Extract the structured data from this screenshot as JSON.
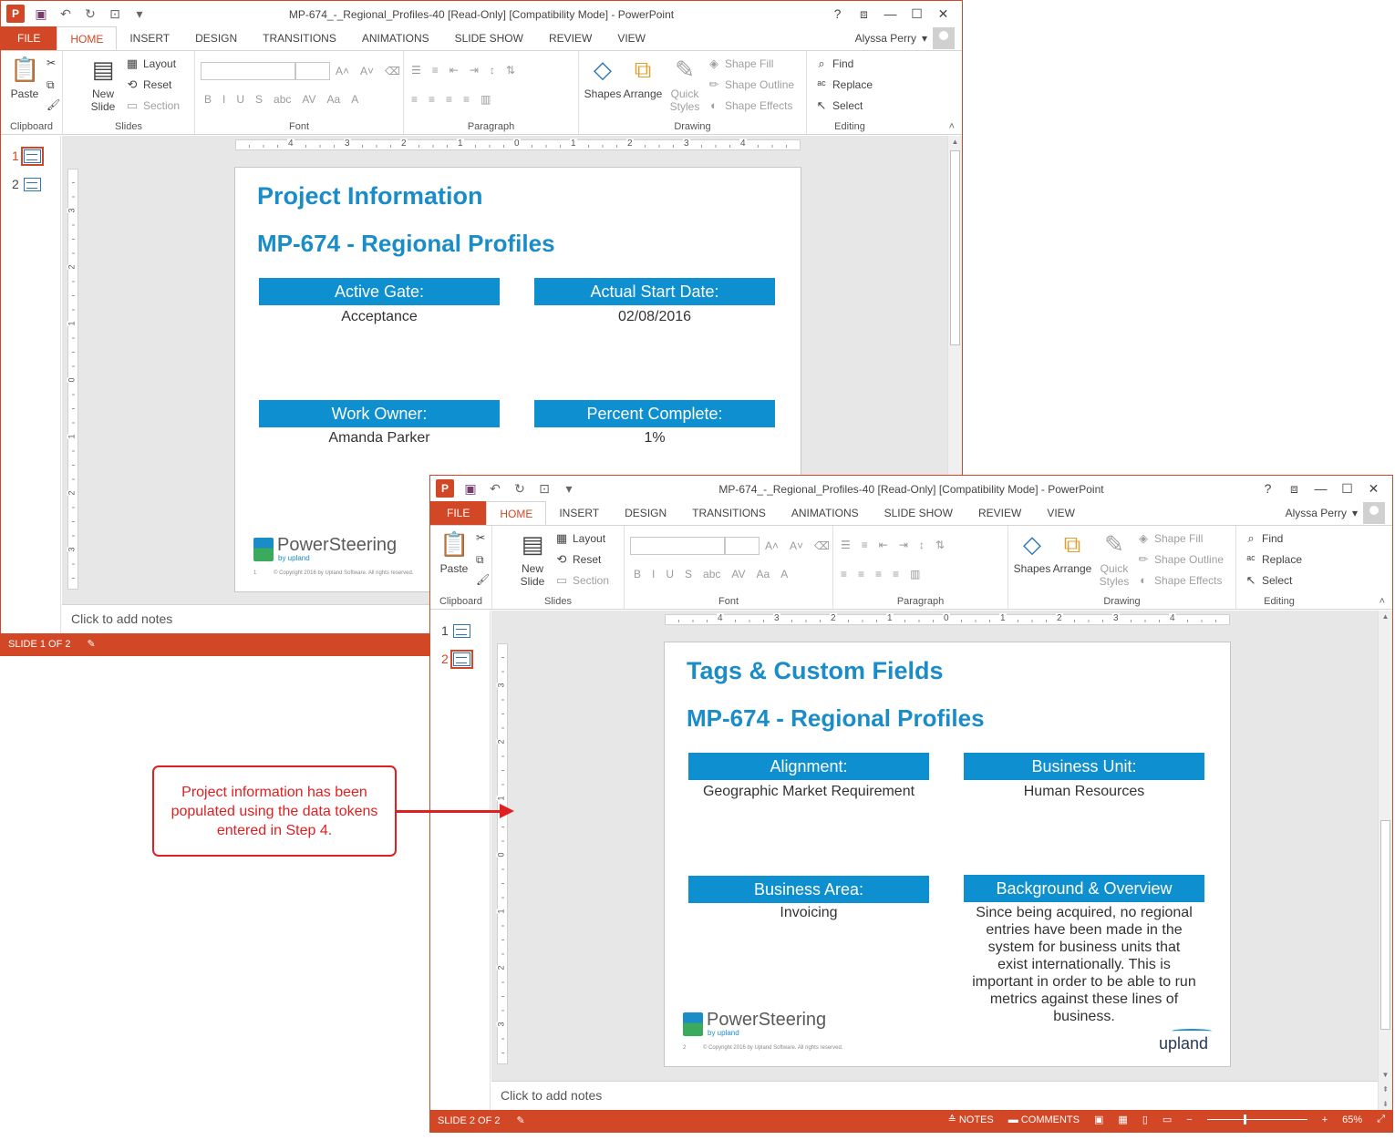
{
  "window1": {
    "title": "MP-674_-_Regional_Profiles-40 [Read-Only] [Compatibility Mode] - PowerPoint",
    "user": "Alyssa Perry",
    "status": "SLIDE 1 OF 2",
    "notes_placeholder": "Click to add notes",
    "slide": {
      "title": "Project Information",
      "subtitle": "MP-674 - Regional Profiles",
      "fields": [
        {
          "label": "Active Gate:",
          "value": "Acceptance"
        },
        {
          "label": "Actual Start Date:",
          "value": "02/08/2016"
        },
        {
          "label": "Work Owner:",
          "value": "Amanda Parker"
        },
        {
          "label": "Percent Complete:",
          "value": "1%"
        }
      ],
      "logo": "PowerSteering",
      "logo_by": "by upland",
      "page_num": "1",
      "copyright": "© Copyright 2016 by Upland Software. All rights reserved."
    }
  },
  "window2": {
    "title": "MP-674_-_Regional_Profiles-40 [Read-Only] [Compatibility Mode] - PowerPoint",
    "user": "Alyssa Perry",
    "status": "SLIDE 2 OF 2",
    "notes_placeholder": "Click to add notes",
    "status_right": {
      "notes": "NOTES",
      "comments": "COMMENTS",
      "zoom": "65%"
    },
    "slide": {
      "title": "Tags & Custom Fields",
      "subtitle": "MP-674 - Regional Profiles",
      "fields": [
        {
          "label": "Alignment:",
          "value": "Geographic Market Requirement"
        },
        {
          "label": "Business Unit:",
          "value": "Human Resources"
        },
        {
          "label": "Business Area:",
          "value": "Invoicing"
        },
        {
          "label": "Background & Overview",
          "value": "Since being acquired, no regional entries have been made in the system for business units that exist internationally.  This is important in order to be able to run metrics against these lines of business."
        }
      ],
      "logo": "PowerSteering",
      "logo_by": "by upland",
      "page_num": "2",
      "copyright": "© Copyright 2016 by Upland Software. All rights reserved.",
      "brand": "upland"
    }
  },
  "ribbon": {
    "tabs": [
      "FILE",
      "HOME",
      "INSERT",
      "DESIGN",
      "TRANSITIONS",
      "ANIMATIONS",
      "SLIDE SHOW",
      "REVIEW",
      "VIEW"
    ],
    "active_tab": "HOME",
    "groups": {
      "clipboard": "Clipboard",
      "slides": "Slides",
      "font": "Font",
      "paragraph": "Paragraph",
      "drawing": "Drawing",
      "editing": "Editing"
    },
    "buttons": {
      "paste": "Paste",
      "new_slide_1": "New",
      "new_slide_2": "Slide",
      "layout": "Layout",
      "reset": "Reset",
      "section": "Section",
      "shapes": "Shapes",
      "arrange": "Arrange",
      "quick_styles_1": "Quick",
      "quick_styles_2": "Styles",
      "shape_fill": "Shape Fill",
      "shape_outline": "Shape Outline",
      "shape_effects": "Shape Effects",
      "find": "Find",
      "replace": "Replace",
      "select": "Select"
    },
    "font_tools": [
      "B",
      "I",
      "U",
      "S",
      "abc",
      "AV",
      "Aa",
      "A"
    ]
  },
  "thumbnails": [
    "1",
    "2"
  ],
  "ruler_h": [
    "4",
    "3",
    "2",
    "1",
    "0",
    "1",
    "2",
    "3",
    "4"
  ],
  "ruler_v": [
    "3",
    "2",
    "1",
    "0",
    "1",
    "2",
    "3"
  ],
  "callout": {
    "text": "Project information has been populated using the data tokens entered in Step 4.",
    "color": "#e02020"
  },
  "colors": {
    "accent": "#d24726",
    "field_header": "#0e8fcf",
    "title_blue": "#1a8cc8"
  }
}
